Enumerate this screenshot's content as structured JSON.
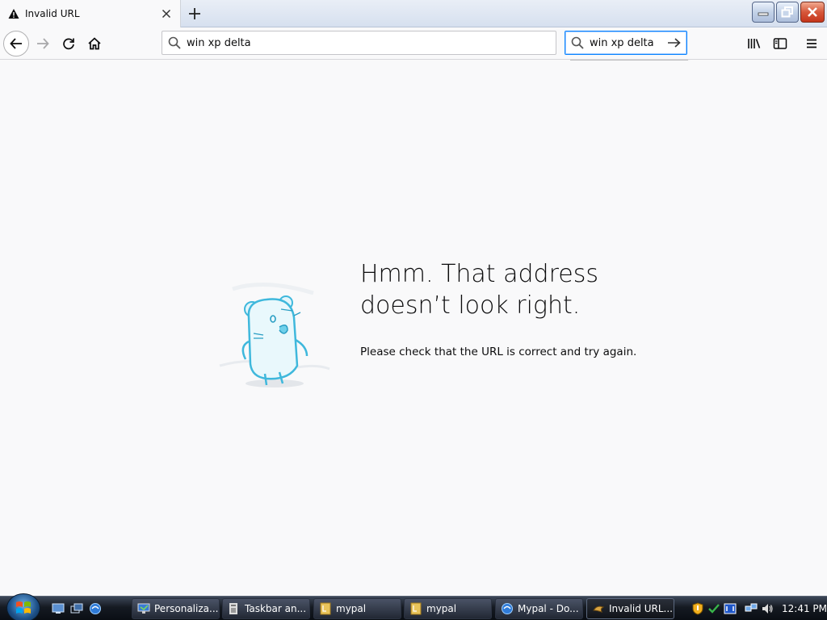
{
  "tab": {
    "title": "Invalid URL"
  },
  "urlbar": {
    "value": "win xp delta"
  },
  "searchbar": {
    "value": "win xp delta"
  },
  "error": {
    "heading_line1": "Hmm. That address",
    "heading_line2": "doesn’t look right.",
    "description": "Please check that the URL is correct and try again."
  },
  "taskbar": {
    "buttons": [
      {
        "label": "Personaliza...",
        "icon": "monitor-icon"
      },
      {
        "label": "Taskbar an...",
        "icon": "taskbar-properties-icon"
      },
      {
        "label": "mypal",
        "icon": "folder-icon"
      },
      {
        "label": "mypal",
        "icon": "folder-icon"
      },
      {
        "label": "Mypal - Do...",
        "icon": "browser-icon"
      },
      {
        "label": "Invalid URL...",
        "icon": "mypal-icon"
      }
    ],
    "clock": "12:41 PM"
  },
  "colors": {
    "accent": "#0a84ff",
    "background": "#f9f9fa",
    "text": "#0c0c0d"
  }
}
